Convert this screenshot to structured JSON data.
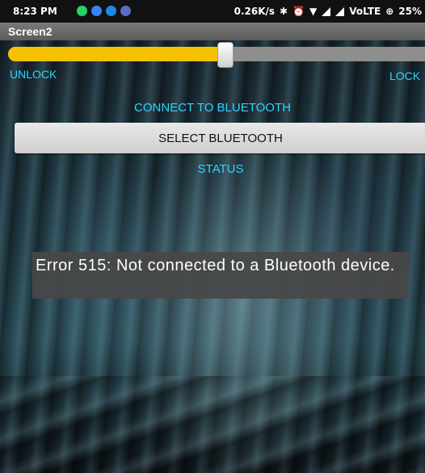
{
  "status_bar": {
    "time": "8:23 PM",
    "network_speed": "0.26K/s",
    "network_type": "VoLTE",
    "battery": "25%",
    "notification_icons": [
      "whatsapp-icon",
      "message-icon",
      "phone-icon",
      "chat-icon"
    ]
  },
  "app": {
    "title": "Screen2"
  },
  "slider": {
    "value_fraction": 0.52,
    "left_label": "UNLOCK",
    "right_label": "LOCK"
  },
  "bluetooth": {
    "connect_label": "CONNECT TO BLUETOOTH",
    "select_button": "SELECT BLUETOOTH",
    "status_label": "STATUS"
  },
  "toast": {
    "message": "Error 515: Not connected to a Bluetooth device."
  },
  "colors": {
    "accent_cyan": "#2fd3ff",
    "slider_fill": "#f4c200",
    "title_bar": "#6a6a6a"
  }
}
